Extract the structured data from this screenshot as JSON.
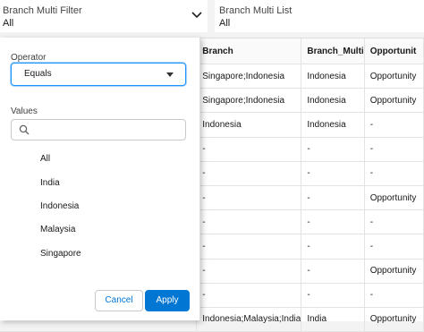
{
  "filters": [
    {
      "label": "Branch Multi Filter",
      "value": "All"
    },
    {
      "label": "Branch Multi List",
      "value": "All"
    }
  ],
  "table": {
    "sort_indicator": "↑",
    "columns": [
      "",
      "Branch",
      "Branch_Multi",
      "Opportunit"
    ],
    "rows": [
      [
        "",
        "Singapore;Indonesia",
        "Indonesia",
        "Opportunity"
      ],
      [
        "",
        "Singapore;Indonesia",
        "Indonesia",
        "Opportunity"
      ],
      [
        "",
        "Indonesia",
        "Indonesia",
        "-"
      ],
      [
        "",
        "-",
        "-",
        "-"
      ],
      [
        "",
        "-",
        "-",
        "-"
      ],
      [
        "",
        "-",
        "-",
        "Opportunity"
      ],
      [
        "",
        "-",
        "-",
        "-"
      ],
      [
        "",
        "-",
        "-",
        "-"
      ],
      [
        "",
        "-",
        "-",
        "Opportunity"
      ],
      [
        "",
        "-",
        "-",
        "-"
      ],
      [
        "",
        "Indonesia;Malaysia;India",
        "India",
        "Opportunity"
      ]
    ]
  },
  "panel": {
    "operator_label": "Operator",
    "operator_value": "Equals",
    "values_label": "Values",
    "search_placeholder": "",
    "options": [
      "All",
      "India",
      "Indonesia",
      "Malaysia",
      "Singapore"
    ],
    "cancel_label": "Cancel",
    "apply_label": "Apply"
  },
  "colors": {
    "accent": "#0176d3",
    "focus": "#1b96ff"
  }
}
